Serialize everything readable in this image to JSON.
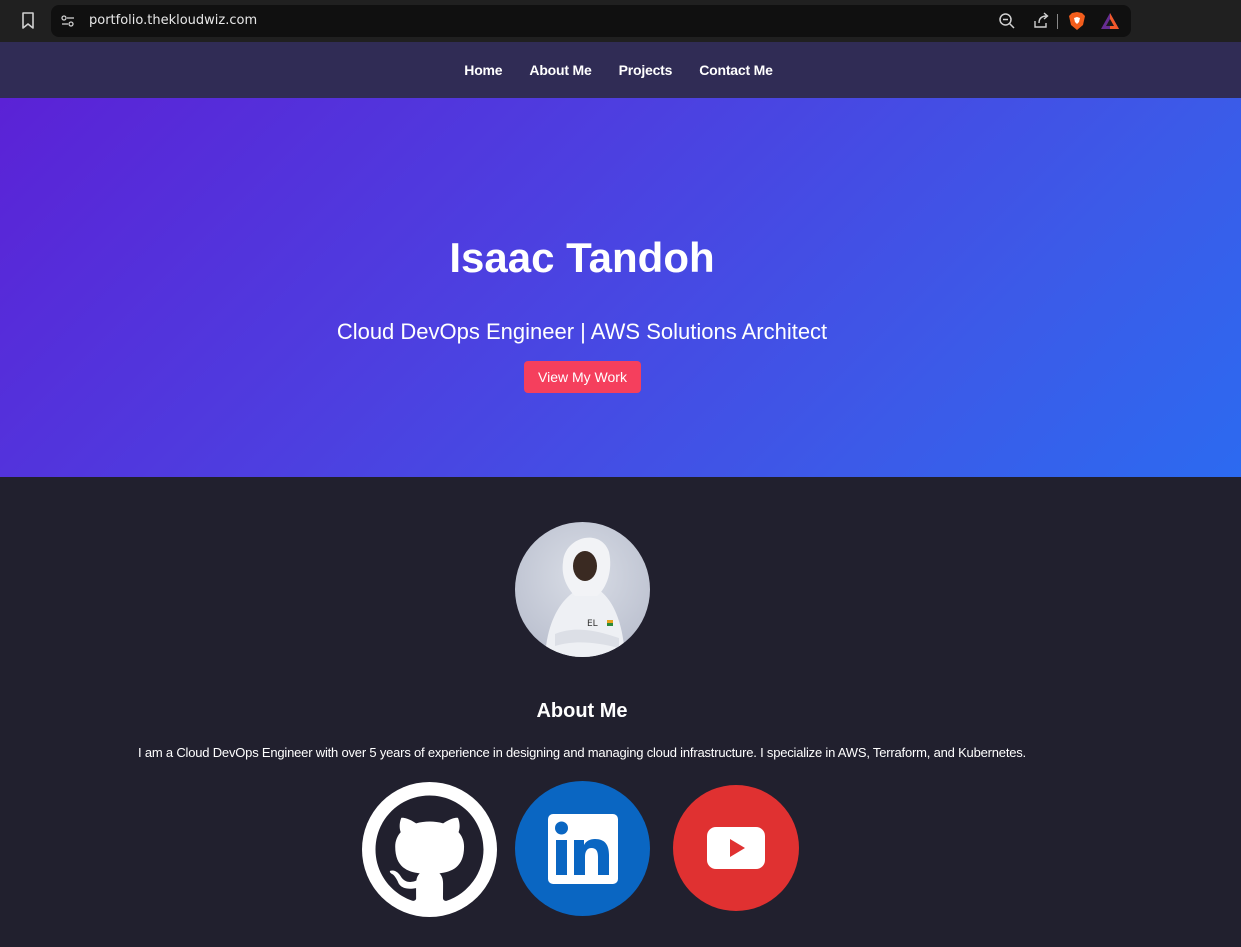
{
  "browser": {
    "url": "portfolio.thekloudwiz.com"
  },
  "nav": {
    "links": [
      "Home",
      "About Me",
      "Projects",
      "Contact Me"
    ]
  },
  "hero": {
    "name": "Isaac Tandoh",
    "title": "Cloud DevOps Engineer | AWS Solutions Architect",
    "cta_label": "View My Work",
    "cta_color": "#f53f5d"
  },
  "about": {
    "heading": "About Me",
    "text": "I am a Cloud DevOps Engineer with over 5 years of experience in designing and managing cloud infrastructure. I specialize in AWS, Terraform, and Kubernetes."
  },
  "social": [
    {
      "name": "github-icon",
      "color": "#ffffff"
    },
    {
      "name": "linkedin-icon",
      "color": "#0a66c2"
    },
    {
      "name": "youtube-icon",
      "color": "#e03131"
    }
  ]
}
